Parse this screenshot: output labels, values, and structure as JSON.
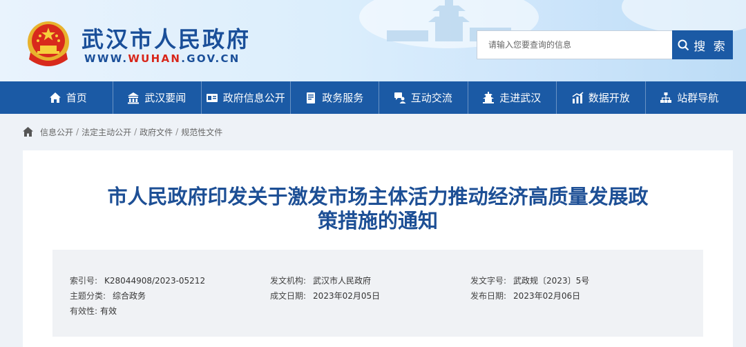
{
  "header": {
    "site_title": "武汉市人民政府",
    "site_url_prefix": "WWW.",
    "site_url_brand": "WUHAN",
    "site_url_suffix": ".GOV.CN",
    "search_placeholder": "请输入您要查询的信息",
    "search_button": "搜 索"
  },
  "nav": [
    {
      "label": "首页",
      "icon": "home-icon"
    },
    {
      "label": "武汉要闻",
      "icon": "building-icon"
    },
    {
      "label": "政府信息公开",
      "icon": "id-card-icon"
    },
    {
      "label": "政务服务",
      "icon": "document-icon"
    },
    {
      "label": "互动交流",
      "icon": "chat-user-icon"
    },
    {
      "label": "走进武汉",
      "icon": "pagoda-icon"
    },
    {
      "label": "数据开放",
      "icon": "chart-icon"
    },
    {
      "label": "站群导航",
      "icon": "sitemap-icon"
    }
  ],
  "breadcrumb": [
    "信息公开",
    "法定主动公开",
    "政府文件",
    "规范性文件"
  ],
  "document": {
    "title_line1": "市人民政府印发关于激发市场主体活力推动经济高质量发展政",
    "title_line2": "策措施的通知",
    "meta": {
      "index_label": "索引号:",
      "index_value": "K28044908/2023-05212",
      "agency_label": "发文机构:",
      "agency_value": "武汉市人民政府",
      "doc_no_label": "发文字号:",
      "doc_no_value": "武政规〔2023〕5号",
      "topic_label": "主题分类:",
      "topic_value": "综合政务",
      "created_label": "成文日期:",
      "created_value": "2023年02月05日",
      "published_label": "发布日期:",
      "published_value": "2023年02月06日",
      "validity_label": "有效性:",
      "validity_value": "有效"
    }
  },
  "colors": {
    "brand_blue": "#1b5aa5",
    "title_blue": "#1d4f95",
    "url_red": "#d8261a"
  }
}
